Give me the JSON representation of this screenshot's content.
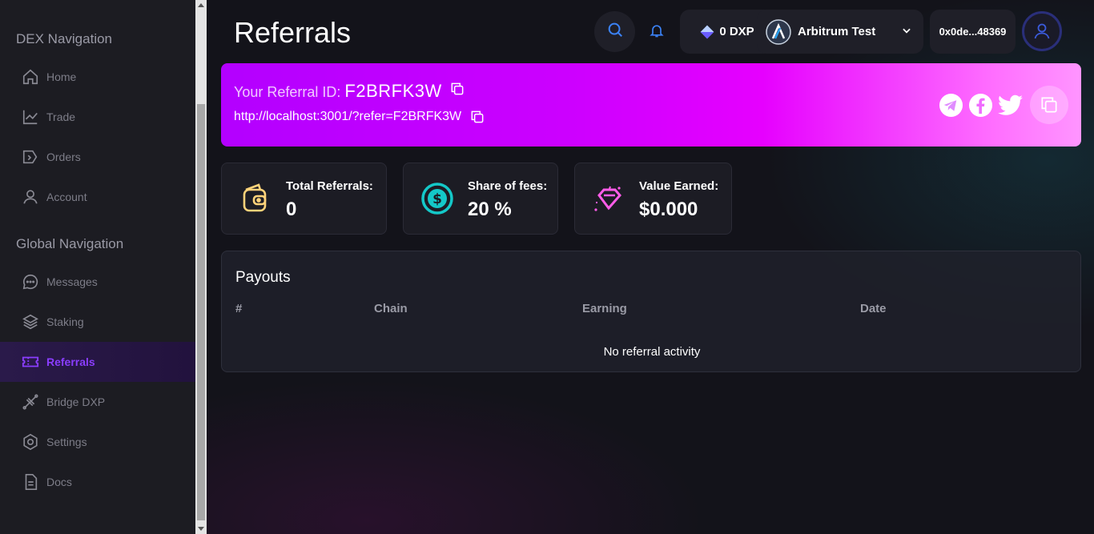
{
  "sidebar": {
    "dex_title": "DEX Navigation",
    "global_title": "Global Navigation",
    "dex_items": [
      {
        "label": "Home",
        "icon": "home-icon"
      },
      {
        "label": "Trade",
        "icon": "chart-icon"
      },
      {
        "label": "Orders",
        "icon": "orders-icon"
      },
      {
        "label": "Account",
        "icon": "user-icon"
      }
    ],
    "global_items": [
      {
        "label": "Messages",
        "icon": "message-icon"
      },
      {
        "label": "Staking",
        "icon": "layers-icon"
      },
      {
        "label": "Referrals",
        "icon": "ticket-icon",
        "active": true
      },
      {
        "label": "Bridge DXP",
        "icon": "bridge-icon"
      },
      {
        "label": "Settings",
        "icon": "settings-icon"
      },
      {
        "label": "Docs",
        "icon": "docs-icon"
      }
    ]
  },
  "header": {
    "title": "Referrals",
    "balance": "0 DXP",
    "network": "Arbitrum Test",
    "wallet": "0x0de...48369"
  },
  "referral": {
    "id_label": "Your Referral ID:",
    "id_value": "F2BRFK3W",
    "link": "http://localhost:3001/?refer=F2BRFK3W"
  },
  "stats": [
    {
      "label": "Total Referrals:",
      "value": "0",
      "icon": "wallet-icon"
    },
    {
      "label": "Share of fees:",
      "value": "20 %",
      "icon": "dollar-coin-icon"
    },
    {
      "label": "Value Earned:",
      "value": "$0.000",
      "icon": "diamond-icon"
    }
  ],
  "payouts": {
    "title": "Payouts",
    "columns": [
      "#",
      "Chain",
      "Earning",
      "Date"
    ],
    "empty_message": "No referral activity"
  },
  "colors": {
    "accent": "#8a3dff",
    "banner_start": "#b300ff",
    "banner_end": "#ff95ff"
  }
}
